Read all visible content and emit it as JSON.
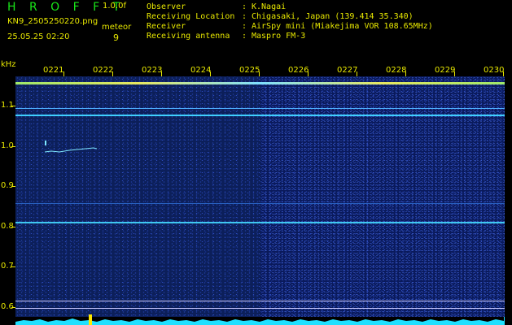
{
  "header": {
    "app_title": "H R O F F T",
    "version": "1.0.0f",
    "filename": "KN9_2505250220.png",
    "timestamp": "25.05.25 02:20",
    "meteor_label": "meteor",
    "meteor_count": "9"
  },
  "meta": {
    "observer_key": "Observer",
    "observer_val": "K.Nagai",
    "location_key": "Receiving Location",
    "location_val": "Chigasaki, Japan (139.414 35.340)",
    "receiver_key": "Receiver",
    "receiver_val": "AirSpy mini (Miakejima VOR 108.65MHz)",
    "antenna_key": "Receiving antenna",
    "antenna_val": "Maspro FM-3",
    "colon": ":"
  },
  "axis": {
    "y_unit": "kHz",
    "y_ticks": [
      "1.1",
      "1.0",
      "0.9",
      "0.8",
      "0.7",
      "0.6"
    ],
    "x_ticks": [
      "0221",
      "0222",
      "0223",
      "0224",
      "0225",
      "0226",
      "0227",
      "0228",
      "0229",
      "0230"
    ]
  },
  "colors": {
    "label": "#e8e800",
    "title": "#19e619",
    "background": "#000000",
    "waterfall": "#0c1f5a",
    "carrier": "#1fe0ff"
  }
}
